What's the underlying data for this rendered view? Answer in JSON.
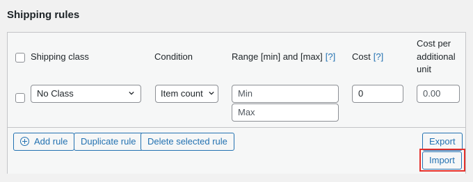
{
  "page": {
    "title": "Shipping rules"
  },
  "table": {
    "headers": {
      "shipping_class": "Shipping class",
      "condition": "Condition",
      "range": "Range [min] and [max]",
      "range_help": "[?]",
      "cost": "Cost",
      "cost_help": "[?]",
      "cost_additional_line1": "Cost per",
      "cost_additional_line2": "additional",
      "cost_additional_line3": "unit"
    },
    "rows": [
      {
        "shipping_class": "No Class",
        "condition": "Item count",
        "min_placeholder": "Min",
        "max_placeholder": "Max",
        "cost": "0",
        "cost_additional": "0.00"
      }
    ]
  },
  "actions": {
    "add_rule": "Add rule",
    "duplicate_rule": "Duplicate rule",
    "delete_selected_rule": "Delete selected rule",
    "export": "Export",
    "import": "Import"
  },
  "colors": {
    "accent": "#2271b1",
    "highlight": "#e4302b",
    "border": "#c3c4c7"
  }
}
